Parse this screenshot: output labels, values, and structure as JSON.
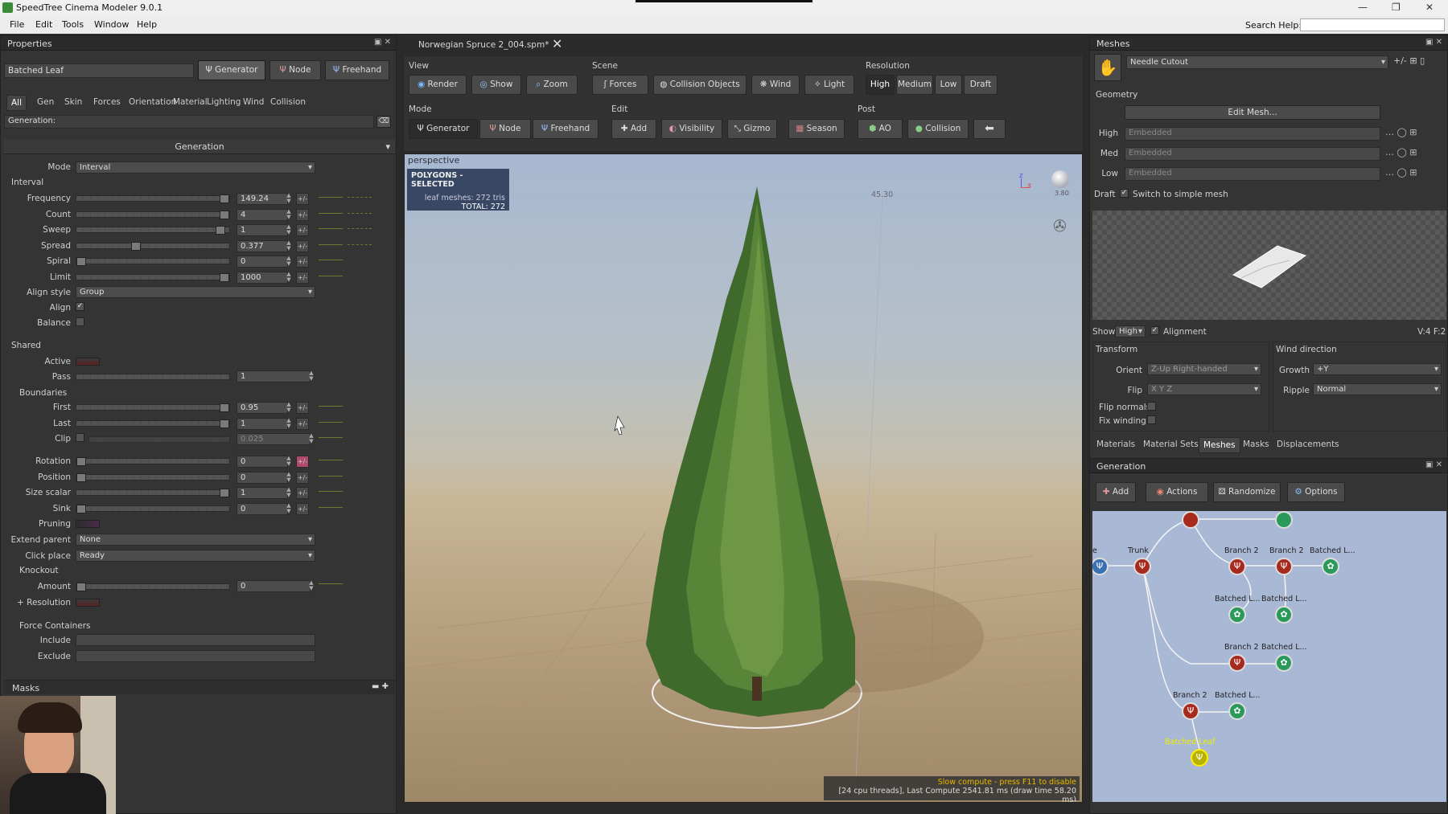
{
  "window": {
    "title": "SpeedTree Cinema Modeler 9.0.1"
  },
  "menu": {
    "items": [
      "File",
      "Edit",
      "Tools",
      "Window",
      "Help"
    ],
    "search_label": "Search Help:"
  },
  "properties": {
    "title": "Properties",
    "selected_name": "Batched Leaf",
    "mode_buttons": [
      "Generator",
      "Node",
      "Freehand"
    ],
    "tabs": [
      "All",
      "Gen",
      "Skin",
      "Forces",
      "Orientation",
      "Material",
      "Lighting",
      "Wind",
      "Collision"
    ],
    "filter_label": "Generation:",
    "generation_header": "Generation",
    "mode_label": "Mode",
    "mode_value": "Interval",
    "interval": {
      "title": "Interval",
      "rows": [
        {
          "label": "Frequency",
          "value": "149.24",
          "pos": 0.99
        },
        {
          "label": "Count",
          "value": "4",
          "pos": 0.99
        },
        {
          "label": "Sweep",
          "value": "1",
          "pos": 0.96
        },
        {
          "label": "Spread",
          "value": "0.377",
          "pos": 0.38
        },
        {
          "label": "Spiral",
          "value": "0",
          "pos": 0.0
        },
        {
          "label": "Limit",
          "value": "1000",
          "pos": 0.99
        }
      ],
      "align_style_label": "Align style",
      "align_style_value": "Group",
      "align_label": "Align",
      "balance_label": "Balance"
    },
    "shared": {
      "title": "Shared",
      "active_label": "Active",
      "pass_label": "Pass",
      "pass_value": "1"
    },
    "boundaries": {
      "title": "Boundaries",
      "rows": [
        {
          "label": "First",
          "value": "0.95",
          "pos": 0.99
        },
        {
          "label": "Last",
          "value": "1",
          "pos": 0.99
        }
      ],
      "clip_label": "Clip",
      "clip_value": "0.025"
    },
    "transform_rows": [
      {
        "label": "Rotation",
        "value": "0",
        "pos": 0.0
      },
      {
        "label": "Position",
        "value": "0",
        "pos": 0.0
      },
      {
        "label": "Size scalar",
        "value": "1",
        "pos": 0.99
      },
      {
        "label": "Sink",
        "value": "0",
        "pos": 0.0
      }
    ],
    "pruning_label": "Pruning",
    "extend_parent_label": "Extend parent",
    "extend_parent_value": "None",
    "click_place_label": "Click place",
    "click_place_value": "Ready",
    "knockout": {
      "title": "Knockout",
      "amount_label": "Amount",
      "amount_value": "0",
      "resolution_label": "+ Resolution"
    },
    "force_containers": {
      "title": "Force Containers",
      "include_label": "Include",
      "exclude_label": "Exclude"
    },
    "masks_label": "Masks"
  },
  "document": {
    "tab_title": "Norwegian Spruce 2_004.spm*"
  },
  "toolbar": {
    "view": {
      "label": "View",
      "buttons": [
        "Render",
        "Show",
        "Zoom"
      ]
    },
    "scene": {
      "label": "Scene",
      "buttons": [
        "Forces",
        "Collision Objects",
        "Wind",
        "Light"
      ]
    },
    "resolution": {
      "label": "Resolution",
      "buttons": [
        "High",
        "Medium",
        "Low",
        "Draft"
      ]
    },
    "mode": {
      "label": "Mode",
      "buttons": [
        "Generator",
        "Node",
        "Freehand"
      ]
    },
    "edit": {
      "label": "Edit",
      "buttons": [
        "Add",
        "Visibility",
        "Gizmo",
        "Season"
      ]
    },
    "post": {
      "label": "Post",
      "buttons": [
        "AO",
        "Collision"
      ]
    }
  },
  "viewport": {
    "camera_label": "perspective",
    "selection_title": "POLYGONS - SELECTED",
    "leaf_meshes": "leaf meshes: 272 tris",
    "total": "TOTAL: 272",
    "height_readout": "45.30",
    "axis_z": "z",
    "axis_x": "x",
    "small_readout": "3.80",
    "warning": "Slow compute - press F11 to disable",
    "stats": "[24 cpu threads], Last Compute 2541.81 ms (draw time 58.20 ms)"
  },
  "meshes": {
    "title": "Meshes",
    "mesh_name": "Needle Cutout",
    "geometry_label": "Geometry",
    "edit_mesh": "Edit Mesh...",
    "lods": [
      {
        "label": "High",
        "value": "Embedded"
      },
      {
        "label": "Med",
        "value": "Embedded"
      },
      {
        "label": "Low",
        "value": "Embedded"
      }
    ],
    "draft_label": "Draft",
    "draft_option": "Switch to simple mesh",
    "show_label": "Show",
    "show_value": "High",
    "alignment_label": "Alignment",
    "vf": "V:4 F:2",
    "transform": {
      "title": "Transform",
      "orient_label": "Orient",
      "orient_value": "Z-Up Right-handed",
      "flip_label": "Flip",
      "flip_value": "X Y Z",
      "flip_normals": "Flip normals",
      "fix_winding": "Fix winding"
    },
    "wind": {
      "title": "Wind direction",
      "growth_label": "Growth",
      "growth_value": "+Y",
      "ripple_label": "Ripple",
      "ripple_value": "Normal"
    },
    "tabs": [
      "Materials",
      "Material Sets",
      "Meshes",
      "Masks",
      "Displacements"
    ],
    "active_tab": "Meshes"
  },
  "generation": {
    "title": "Generation",
    "buttons": [
      "Add",
      "Actions",
      "Randomize",
      "Options"
    ],
    "nodes": [
      {
        "label": "Tree",
        "type": "tree"
      },
      {
        "label": "Trunk",
        "type": "trunk"
      },
      {
        "label": "Branch 2",
        "type": "trunk"
      },
      {
        "label": "Branch 2",
        "type": "trunk"
      },
      {
        "label": "Batched L...",
        "type": "leaf"
      },
      {
        "label": "Batched L...",
        "type": "leaf"
      },
      {
        "label": "Batched L...",
        "type": "leaf"
      },
      {
        "label": "Branch 2",
        "type": "trunk"
      },
      {
        "label": "Batched L...",
        "type": "leaf"
      },
      {
        "label": "Branch 2",
        "type": "trunk"
      },
      {
        "label": "Batched L...",
        "type": "leaf"
      },
      {
        "label": "Batched Leaf",
        "type": "selected"
      }
    ]
  }
}
